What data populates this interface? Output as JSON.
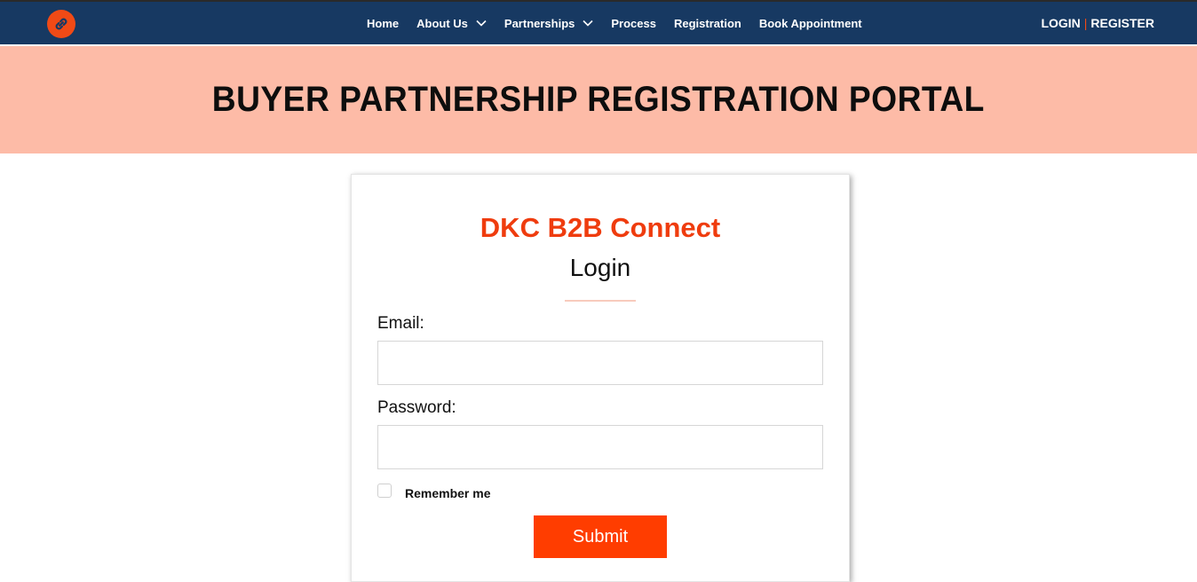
{
  "nav": {
    "logo_icon": "link-chain-icon",
    "items": [
      {
        "label": "Home",
        "dropdown": false
      },
      {
        "label": "About Us",
        "dropdown": true
      },
      {
        "label": "Partnerships",
        "dropdown": true
      },
      {
        "label": "Process",
        "dropdown": false
      },
      {
        "label": "Registration",
        "dropdown": false
      },
      {
        "label": "Book Appointment",
        "dropdown": false
      }
    ],
    "login_label": "LOGIN",
    "separator": "|",
    "register_label": "REGISTER"
  },
  "hero": {
    "title": "BUYER PARTNERSHIP REGISTRATION PORTAL"
  },
  "login_form": {
    "brand": "DKC B2B Connect",
    "title": "Login",
    "email_label": "Email:",
    "email_value": "",
    "password_label": "Password:",
    "password_value": "",
    "remember_label": "Remember me",
    "remember_checked": false,
    "submit_label": "Submit"
  },
  "colors": {
    "navbar_bg": "#173962",
    "accent": "#ef3c0e",
    "hero_bg": "#fdbba7",
    "submit_bg": "#ff3d00"
  }
}
